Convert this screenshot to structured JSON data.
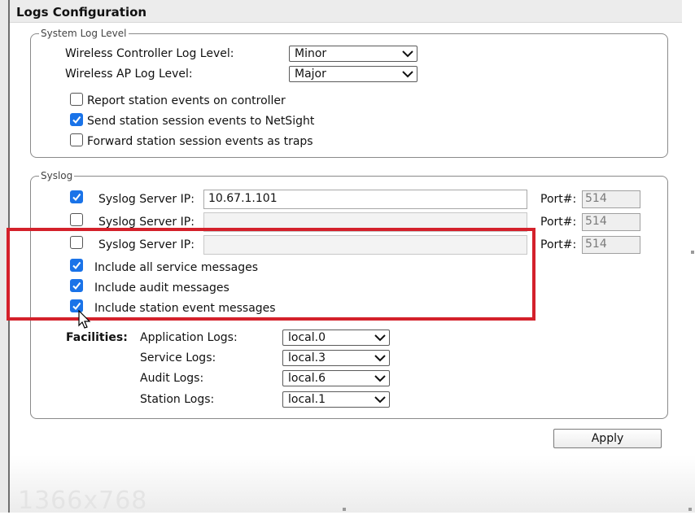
{
  "title": "Logs Configuration",
  "system_log": {
    "legend": "System Log Level",
    "controller_label": "Wireless Controller Log Level:",
    "controller_value": "Minor",
    "ap_label": "Wireless AP Log Level:",
    "ap_value": "Major",
    "checks": [
      {
        "label": "Report station events on controller",
        "checked": false
      },
      {
        "label": "Send station session events to NetSight",
        "checked": true
      },
      {
        "label": "Forward station session events as traps",
        "checked": false
      }
    ]
  },
  "syslog": {
    "legend": "Syslog",
    "servers": [
      {
        "label": "Syslog Server IP:",
        "value": "10.67.1.101",
        "port_label": "Port#:",
        "port": "514",
        "checked": true
      },
      {
        "label": "Syslog Server IP:",
        "value": "",
        "port_label": "Port#:",
        "port": "514",
        "checked": false
      },
      {
        "label": "Syslog Server IP:",
        "value": "",
        "port_label": "Port#:",
        "port": "514",
        "checked": false
      }
    ],
    "includes": [
      {
        "label": "Include all service messages",
        "checked": true
      },
      {
        "label": "Include audit messages",
        "checked": true
      },
      {
        "label": "Include station event messages",
        "checked": true
      }
    ],
    "facilities_label": "Facilities:",
    "facilities": [
      {
        "label": "Application Logs:",
        "value": "local.0"
      },
      {
        "label": "Service Logs:",
        "value": "local.3"
      },
      {
        "label": "Audit Logs:",
        "value": "local.6"
      },
      {
        "label": "Station Logs:",
        "value": "local.1"
      }
    ]
  },
  "apply_label": "Apply",
  "watermark": "1366x768",
  "colors": {
    "highlight": "#d4212b",
    "checkbox": "#1a73e8"
  }
}
